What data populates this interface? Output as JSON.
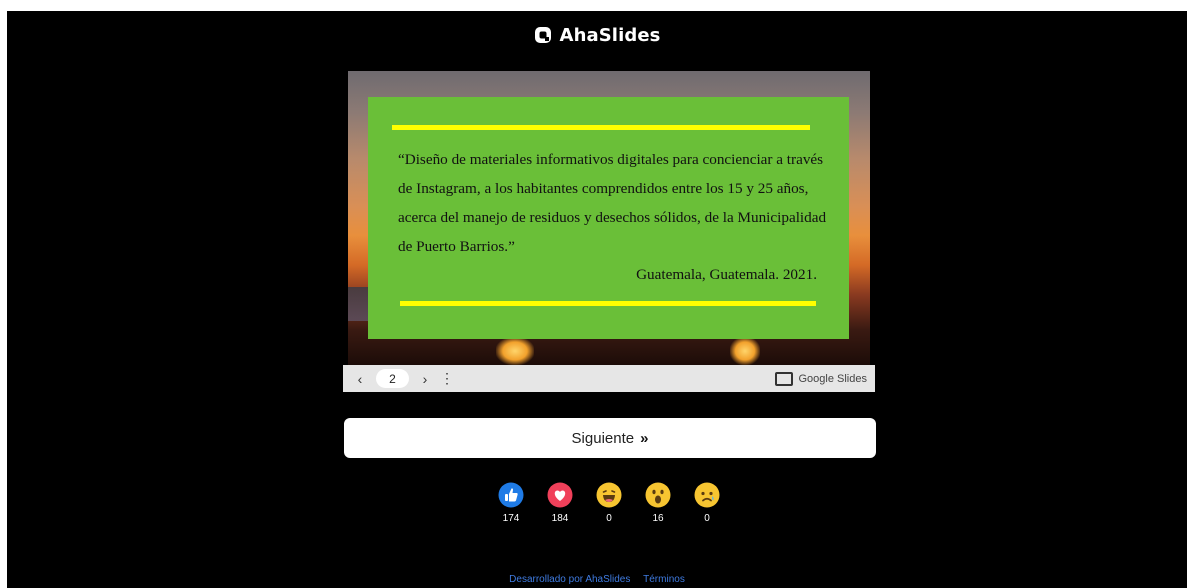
{
  "header": {
    "brand": "AhaSlides"
  },
  "slide": {
    "quote": "“Diseño de materiales informativos digitales para concienciar a través de Instagram, a los habitantes comprendidos entre los 15 y 25 años, acerca del manejo de residuos y desechos sólidos, de la Municipalidad de Puerto Barrios.”",
    "signature": "Guatemala, Guatemala. 2021.",
    "colors": {
      "card": "#6abf38",
      "bars": "#ffff00"
    }
  },
  "controls": {
    "prev_icon": "chevron-left-icon",
    "page": "2",
    "next_icon": "chevron-right-icon",
    "menu_icon": "more-vertical-icon",
    "provider_label": "Google Slides"
  },
  "next_button": {
    "label": "Siguiente",
    "icon": "double-chevron-right-icon"
  },
  "reactions": [
    {
      "name": "like",
      "count": "174",
      "color": "#1f7be6"
    },
    {
      "name": "love",
      "count": "184",
      "color": "#f0405a"
    },
    {
      "name": "haha",
      "count": "0",
      "color": "#f7c531"
    },
    {
      "name": "wow",
      "count": "16",
      "color": "#f7c531"
    },
    {
      "name": "sad",
      "count": "0",
      "color": "#f7c531"
    }
  ],
  "footer": {
    "powered_by": "Desarrollado por AhaSlides",
    "terms": "Términos"
  }
}
